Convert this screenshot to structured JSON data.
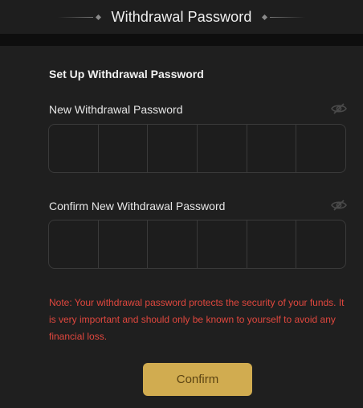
{
  "header": {
    "title": "Withdrawal Password"
  },
  "form": {
    "section_title": "Set Up Withdrawal Password",
    "new_password": {
      "label": "New Withdrawal Password",
      "visibility_icon": "eye-slash-icon",
      "digits": [
        "",
        "",
        "",
        "",
        "",
        ""
      ]
    },
    "confirm_password": {
      "label": "Confirm New Withdrawal Password",
      "visibility_icon": "eye-slash-icon",
      "digits": [
        "",
        "",
        "",
        "",
        "",
        ""
      ]
    },
    "note": "Note: Your withdrawal password protects the security of your funds. It is very important and should only be known to yourself to avoid any financial loss.",
    "confirm_label": "Confirm"
  },
  "colors": {
    "background": "#1f1f1f",
    "note": "#e0473e",
    "button": "#d1ac50",
    "button_text": "#5b4312"
  }
}
